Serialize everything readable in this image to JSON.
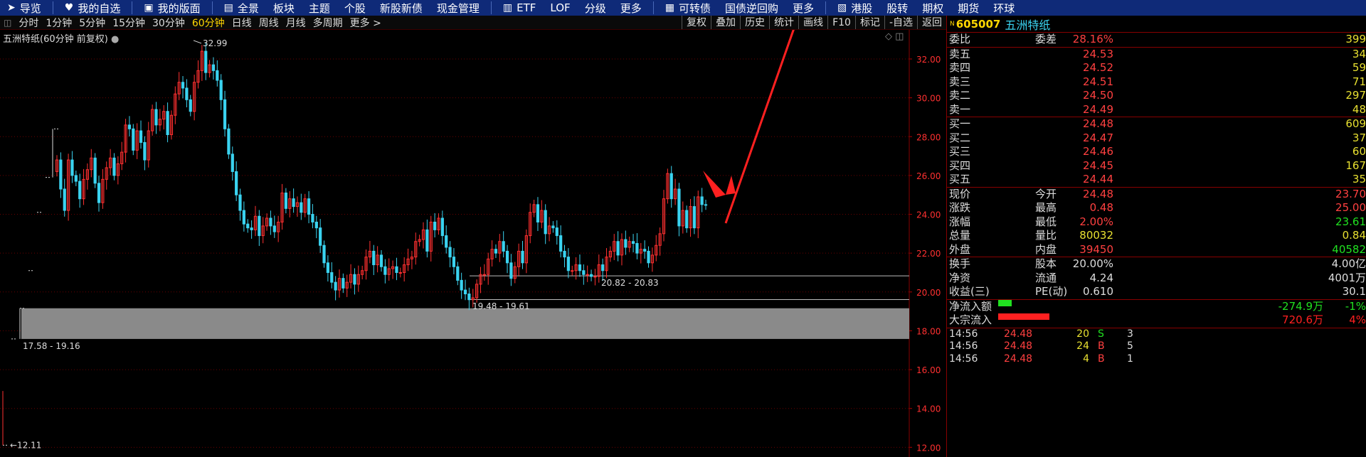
{
  "topnav": [
    {
      "icon": "send-icon",
      "glyph": "➤",
      "label": "导览"
    },
    {
      "icon": "heart-icon",
      "glyph": "♥",
      "label": "我的自选"
    },
    {
      "icon": "layout-icon",
      "glyph": "▣",
      "label": "我的版面"
    },
    {
      "icon": "chart-icon",
      "glyph": "▤",
      "label": "全景"
    },
    {
      "label": "板块"
    },
    {
      "label": "主题"
    },
    {
      "label": "个股"
    },
    {
      "label": "新股新债"
    },
    {
      "label": "现金管理"
    },
    {
      "icon": "etf-icon",
      "glyph": "▥",
      "label": "ETF"
    },
    {
      "label": "LOF"
    },
    {
      "label": "分级"
    },
    {
      "label": "更多"
    },
    {
      "icon": "bond-icon",
      "glyph": "▦",
      "label": "可转债"
    },
    {
      "label": "国债逆回购"
    },
    {
      "label": "更多"
    },
    {
      "icon": "hk-icon",
      "glyph": "▧",
      "label": "港股"
    },
    {
      "label": "股转"
    },
    {
      "label": "期权"
    },
    {
      "label": "期货"
    },
    {
      "label": "环球"
    }
  ],
  "periods": [
    "分时",
    "1分钟",
    "5分钟",
    "15分钟",
    "30分钟",
    "60分钟",
    "日线",
    "周线",
    "月线",
    "多周期",
    "更多 >"
  ],
  "active_period": "60分钟",
  "right_buttons": [
    "复权",
    "叠加",
    "历史",
    "统计",
    "画线",
    "F10",
    "标记",
    "-自选",
    "返回"
  ],
  "chart_title": "五洲特纸(60分钟 前复权)",
  "stock": {
    "marker": "N",
    "code": "605007",
    "name": "五洲特纸"
  },
  "weibi": {
    "l1": "委比",
    "v1": "28.16%",
    "l2": "委差",
    "v2": "399"
  },
  "asks": [
    {
      "label": "卖五",
      "price": "24.53",
      "vol": "34"
    },
    {
      "label": "卖四",
      "price": "24.52",
      "vol": "59"
    },
    {
      "label": "卖三",
      "price": "24.51",
      "vol": "71"
    },
    {
      "label": "卖二",
      "price": "24.50",
      "vol": "297"
    },
    {
      "label": "卖一",
      "price": "24.49",
      "vol": "48"
    }
  ],
  "bids": [
    {
      "label": "买一",
      "price": "24.48",
      "vol": "609"
    },
    {
      "label": "买二",
      "price": "24.47",
      "vol": "37"
    },
    {
      "label": "买三",
      "price": "24.46",
      "vol": "60"
    },
    {
      "label": "买四",
      "price": "24.45",
      "vol": "167"
    },
    {
      "label": "买五",
      "price": "24.44",
      "vol": "35"
    }
  ],
  "quote": [
    {
      "l1": "现价",
      "v1": "24.48",
      "l2": "今开",
      "v2": "23.70",
      "c1": "r",
      "c2": "r"
    },
    {
      "l1": "涨跌",
      "v1": "0.48",
      "l2": "最高",
      "v2": "25.00",
      "c1": "r",
      "c2": "r"
    },
    {
      "l1": "涨幅",
      "v1": "2.00%",
      "l2": "最低",
      "v2": "23.61",
      "c1": "r",
      "c2": "g"
    },
    {
      "l1": "总量",
      "v1": "80032",
      "l2": "量比",
      "v2": "0.84",
      "c1": "y",
      "c2": "y"
    },
    {
      "l1": "外盘",
      "v1": "39450",
      "l2": "内盘",
      "v2": "40582",
      "c1": "r",
      "c2": "g"
    }
  ],
  "fund": [
    {
      "l1": "换手",
      "v1": "20.00%",
      "l2": "股本",
      "v2": "4.00亿"
    },
    {
      "l1": "净资",
      "v1": "4.24",
      "l2": "流通",
      "v2": "4001万"
    },
    {
      "l1": "收益(三)",
      "v1": "0.610",
      "l2": "PE(动)",
      "v2": "30.1"
    }
  ],
  "flows": [
    {
      "label": "净流入额",
      "value": "-274.9万",
      "pct": "-1%",
      "color": "#20e020",
      "bar_fraction": 0.12
    },
    {
      "label": "大宗流入",
      "value": "720.6万",
      "pct": "4%",
      "color": "#ff2020",
      "bar_fraction": 0.45
    }
  ],
  "ticks": [
    {
      "time": "14:56",
      "price": "24.48",
      "vol": "20",
      "side": "S",
      "n": "3"
    },
    {
      "time": "14:56",
      "price": "24.48",
      "vol": "24",
      "side": "B",
      "n": "5"
    },
    {
      "time": "14:56",
      "price": "24.48",
      "vol": "4",
      "side": "B",
      "n": "1"
    }
  ],
  "chart_data": {
    "type": "candlestick",
    "y_ticks": [
      "32.00",
      "30.00",
      "28.00",
      "26.00",
      "24.00",
      "22.00",
      "20.00",
      "18.00",
      "16.00",
      "14.00",
      "12.00"
    ],
    "ylim": [
      11.5,
      33.5
    ],
    "annotations": {
      "high": "32.99",
      "low": "12.11",
      "zone_a": "17.58 - 19.16",
      "zone_b": "19.48 - 19.61",
      "zone_c": "20.82 - 20.83"
    },
    "zone_a_range": [
      17.58,
      19.16
    ],
    "price_lines": [
      20.83,
      19.61
    ],
    "early_markers": [
      {
        "i": 0,
        "v": 12.11
      },
      {
        "i": 1,
        "v": 17.58
      },
      {
        "i": 2,
        "v": 19.16
      },
      {
        "i": 3,
        "v": 21.1
      },
      {
        "i": 4,
        "v": 24.1
      },
      {
        "i": 5,
        "v": 25.9
      },
      {
        "i": 6,
        "v": 28.4
      }
    ],
    "closes": [
      26.8,
      25.3,
      24.2,
      26.8,
      26.0,
      25.7,
      24.8,
      25.8,
      26.3,
      26.9,
      25.6,
      24.6,
      25.8,
      26.4,
      26.9,
      26.0,
      26.6,
      27.2,
      28.6,
      28.4,
      27.3,
      28.3,
      27.7,
      26.8,
      28.3,
      29.4,
      28.6,
      28.9,
      29.3,
      28.1,
      29.1,
      30.2,
      30.8,
      30.5,
      29.9,
      29.3,
      30.8,
      31.4,
      32.4,
      31.3,
      31.7,
      31.4,
      30.9,
      29.9,
      28.4,
      27.1,
      26.2,
      25.0,
      24.2,
      23.5,
      23.3,
      23.2,
      23.9,
      22.9,
      23.4,
      23.8,
      23.4,
      23.1,
      23.6,
      25.1,
      24.3,
      24.8,
      24.4,
      24.6,
      24.1,
      24.8,
      24.0,
      23.6,
      23.3,
      22.4,
      21.5,
      21.0,
      20.5,
      20.1,
      20.7,
      20.2,
      20.5,
      20.9,
      20.4,
      20.9,
      21.1,
      21.8,
      22.1,
      21.4,
      21.9,
      21.3,
      20.9,
      21.2,
      21.3,
      21.0,
      21.0,
      21.4,
      21.7,
      21.8,
      22.6,
      22.7,
      23.2,
      22.1,
      23.6,
      23.2,
      23.8,
      22.9,
      22.3,
      21.8,
      21.3,
      20.6,
      20.1,
      19.9,
      19.6,
      19.7,
      20.4,
      20.9,
      20.9,
      21.7,
      22.2,
      22.0,
      22.6,
      22.1,
      21.5,
      20.7,
      21.3,
      22.1,
      21.5,
      22.9,
      24.1,
      24.5,
      23.6,
      24.2,
      23.0,
      23.4,
      23.3,
      22.9,
      22.1,
      21.8,
      21.1,
      21.1,
      21.4,
      21.1,
      20.9,
      20.9,
      20.8,
      20.8,
      21.4,
      21.1,
      21.8,
      22.1,
      22.6,
      21.9,
      22.7,
      22.3,
      22.6,
      22.5,
      22.0,
      22.2,
      22.1,
      21.5,
      21.9,
      22.4,
      23.0,
      24.8,
      26.1,
      24.8,
      25.3,
      23.4,
      24.2,
      23.3,
      24.4,
      23.3,
      24.9,
      24.5,
      24.48
    ]
  }
}
